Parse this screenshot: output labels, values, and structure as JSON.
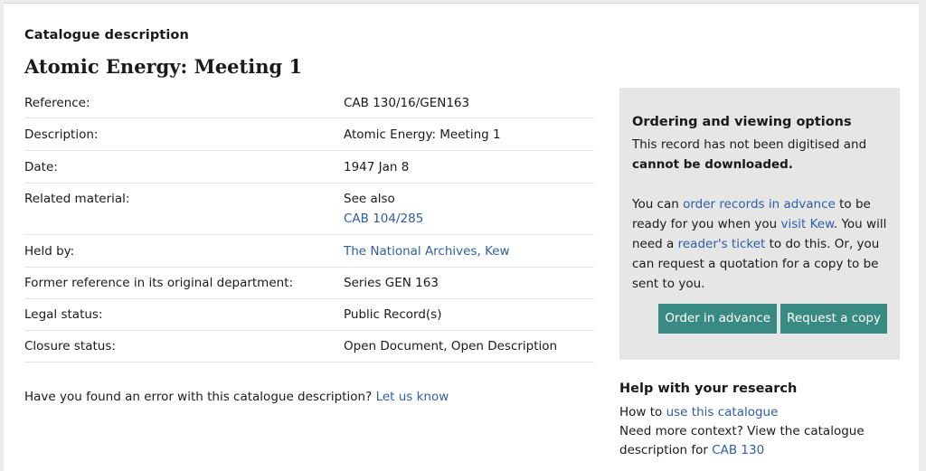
{
  "page": {
    "eyebrow": "Catalogue description",
    "title": "Atomic Energy: Meeting 1"
  },
  "details": [
    {
      "label": "Reference:",
      "value": "CAB 130/16/GEN163"
    },
    {
      "label": "Description:",
      "value": "Atomic Energy: Meeting 1"
    },
    {
      "label": "Date:",
      "value": "1947 Jan 8"
    },
    {
      "label": "Related material:",
      "value": "See also",
      "link": "CAB 104/285"
    },
    {
      "label": "Held by:",
      "link": "The National Archives, Kew"
    },
    {
      "label": "Former reference in its original department:",
      "value": "Series GEN 163"
    },
    {
      "label": "Legal status:",
      "value": "Public Record(s)"
    },
    {
      "label": "Closure status:",
      "value": "Open Document, Open Description"
    }
  ],
  "error": {
    "text": "Have you found an error with this catalogue description?",
    "link": "Let us know"
  },
  "ordering": {
    "heading": "Ordering and viewing options",
    "p1_text": "This record has not been digitised and",
    "p1_bold": "cannot be downloaded.",
    "p2_a": "You can",
    "p2_link1": "order records in advance",
    "p2_b": "to be ready for you when you",
    "p2_link2": "visit Kew",
    "p2_c": ". You will need a",
    "p2_link3": "reader's ticket",
    "p2_d": "to do this. Or, you can request a quotation for a copy to be sent to you.",
    "order_button": "Order in advance",
    "copy_button": "Request a copy"
  },
  "help": {
    "heading": "Help with your research",
    "line1_text": "How to",
    "line1_link": "use this catalogue",
    "line2_text": "Need more context? View the catalogue description for",
    "line2_link": "CAB 130"
  },
  "colors": {
    "button": "#398a83",
    "link": "#2f5ea6",
    "sidebar_bg": "#e6e6e6"
  }
}
